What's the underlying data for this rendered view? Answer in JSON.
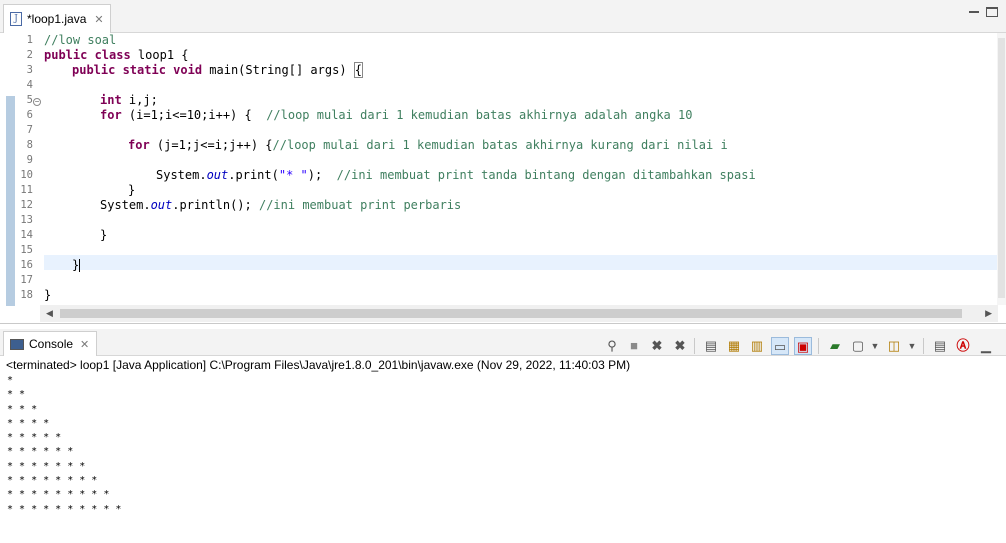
{
  "editor": {
    "tab_label": "*loop1.java",
    "file_icon_glyph": "J",
    "line_numbers": [
      "1",
      "2",
      "3",
      "4",
      "5",
      "6",
      "7",
      "8",
      "9",
      "10",
      "11",
      "12",
      "13",
      "14",
      "15",
      "16",
      "17",
      "18"
    ]
  },
  "code": {
    "l1_cm": "//low soal",
    "l2_kw": "public class",
    "l2_text": " loop1 {",
    "l3_kw": "public static void",
    "l3_text": " main(String[] args) ",
    "l3_brace": "{",
    "l5_kw": "int",
    "l5_text": " i,j;",
    "l6_kw": "for",
    "l6_text": " (i=1;i<=10;i++) {  ",
    "l6_cm": "//loop mulai dari 1 kemudian batas akhirnya adalah angka 10",
    "l8_kw": "for",
    "l8_text": " (j=1;j<=i;j++) {",
    "l8_cm": "//loop mulai dari 1 kemudian batas akhirnya kurang dari nilai i",
    "l10_a": "System.",
    "l10_fld": "out",
    "l10_b": ".print(",
    "l10_str": "\"* \"",
    "l10_c": ");  ",
    "l10_cm": "//ini membuat print tanda bintang dengan ditambahkan spasi",
    "l11_text": "}",
    "l12_a": "System.",
    "l12_fld": "out",
    "l12_b": ".println(); ",
    "l12_cm": "//ini membuat print perbaris",
    "l14_text": "}",
    "l16_text": "}",
    "l18_text": "}"
  },
  "console": {
    "tab_label": "Console",
    "header": "<terminated> loop1 [Java Application] C:\\Program Files\\Java\\jre1.8.0_201\\bin\\javaw.exe (Nov 29, 2022, 11:40:03 PM)",
    "output": [
      "*",
      "* *",
      "* * *",
      "* * * *",
      "* * * * *",
      "* * * * * *",
      "* * * * * * *",
      "* * * * * * * *",
      "* * * * * * * * *",
      "* * * * * * * * * *"
    ]
  },
  "toolbar_icons": [
    "pin-icon",
    "terminate-icon",
    "remove-launch-icon",
    "remove-all-launches-icon",
    "clear-console-icon",
    "scroll-lock-icon",
    "word-wrap-icon",
    "show-on-stdout-icon",
    "show-on-stderr-icon",
    "open-console-icon",
    "display-selected-console-icon",
    "new-console-icon",
    "pin-console-icon",
    "tasks-icon",
    "minimize-icon",
    "maximize-icon"
  ],
  "colors": {
    "keyword": "#7f0055",
    "comment": "#3f7f5f",
    "string": "#2a00ff",
    "field": "#0000c0",
    "current_line": "#e8f2fe"
  }
}
